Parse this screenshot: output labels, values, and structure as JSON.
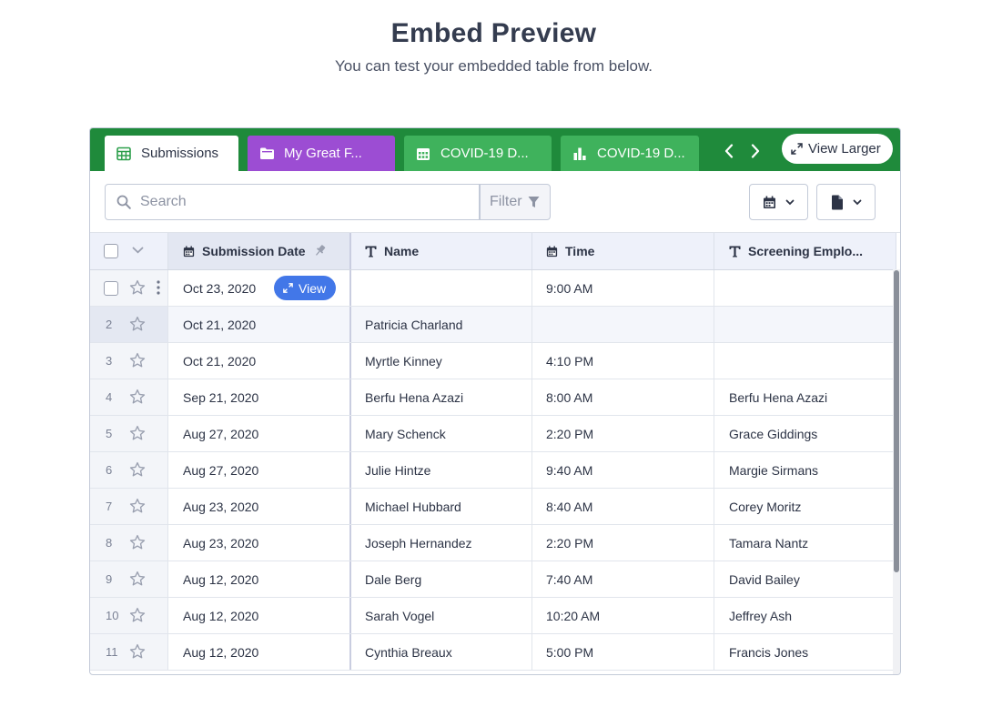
{
  "page": {
    "title": "Embed Preview",
    "subtitle": "You can test your embedded table from below."
  },
  "tabs": [
    {
      "label": "Submissions",
      "icon": "table-icon",
      "active": true
    },
    {
      "label": "My Great F...",
      "icon": "folder-icon",
      "color": "#9c4dd3"
    },
    {
      "label": "COVID-19 D...",
      "icon": "calendar-grid-icon",
      "color": "#3fb25c"
    },
    {
      "label": "COVID-19 D...",
      "icon": "bar-chart-icon",
      "color": "#3fb25c"
    }
  ],
  "tabbar": {
    "view_larger_label": "View Larger",
    "bg": "#1f8a3b"
  },
  "toolbar": {
    "search_placeholder": "Search",
    "filter_label": "Filter"
  },
  "table": {
    "columns": [
      {
        "label": "Submission Date",
        "icon": "calendar-icon",
        "pinned": true
      },
      {
        "label": "Name",
        "icon": "text-icon"
      },
      {
        "label": "Time",
        "icon": "calendar-icon"
      },
      {
        "label": "Screening Emplo...",
        "icon": "text-icon"
      }
    ],
    "view_label": "View",
    "rows": [
      {
        "num": "",
        "date": "Oct 23, 2020",
        "name": "",
        "time": "9:00 AM",
        "employee": ""
      },
      {
        "num": "2",
        "date": "Oct 21, 2020",
        "name": "Patricia Charland",
        "time": "",
        "employee": ""
      },
      {
        "num": "3",
        "date": "Oct 21, 2020",
        "name": "Myrtle Kinney",
        "time": "4:10 PM",
        "employee": ""
      },
      {
        "num": "4",
        "date": "Sep 21, 2020",
        "name": "Berfu Hena Azazi",
        "time": "8:00 AM",
        "employee": "Berfu Hena Azazi"
      },
      {
        "num": "5",
        "date": "Aug 27, 2020",
        "name": "Mary Schenck",
        "time": "2:20 PM",
        "employee": "Grace Giddings"
      },
      {
        "num": "6",
        "date": "Aug 27, 2020",
        "name": "Julie Hintze",
        "time": "9:40 AM",
        "employee": "Margie Sirmans"
      },
      {
        "num": "7",
        "date": "Aug 23, 2020",
        "name": "Michael Hubbard",
        "time": "8:40 AM",
        "employee": "Corey Moritz"
      },
      {
        "num": "8",
        "date": "Aug 23, 2020",
        "name": "Joseph Hernandez",
        "time": "2:20 PM",
        "employee": "Tamara Nantz"
      },
      {
        "num": "9",
        "date": "Aug 12, 2020",
        "name": "Dale Berg",
        "time": "7:40 AM",
        "employee": "David Bailey"
      },
      {
        "num": "10",
        "date": "Aug 12, 2020",
        "name": "Sarah Vogel",
        "time": "10:20 AM",
        "employee": "Jeffrey Ash"
      },
      {
        "num": "11",
        "date": "Aug 12, 2020",
        "name": "Cynthia Breaux",
        "time": "5:00 PM",
        "employee": "Francis Jones"
      }
    ]
  }
}
